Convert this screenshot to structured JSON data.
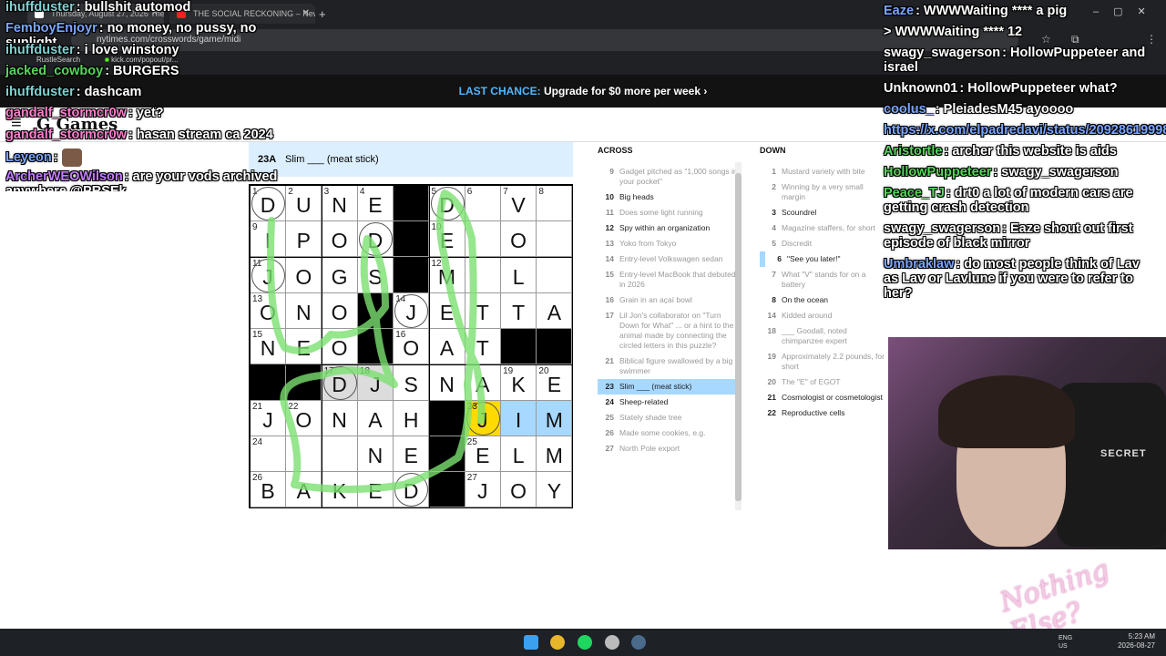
{
  "browser": {
    "tabs": [
      {
        "title": "Thursday, August 27, 2026 The"
      },
      {
        "title": "THE SOCIAL RECKONING – New"
      }
    ],
    "new_tab": "+",
    "url": "nytimes.com/crosswords/game/midi",
    "bookmarks": [
      "RustleSearch",
      "kick.com/popout/pr..."
    ]
  },
  "promo": {
    "highlight": "LAST CHANCE:",
    "text": "Upgrade for $0 more per week",
    "arrow": "›"
  },
  "header": {
    "menu": "≡",
    "logo": "G Games"
  },
  "clue_bar": {
    "number": "23A",
    "text": "Slim ___ (meat stick)"
  },
  "grid": {
    "rows": [
      "DUNE#DV.",
      "IPOD#E.O",
      "JOGS#M.L",
      "ONO#JETTA",
      "NEO#OAT##",
      "##DJSNAKE",
      "JONAH#JIM",
      "....NE#ELM",
      "BAKED#JOY"
    ],
    "cells": [
      [
        "D",
        "U",
        "N",
        "E",
        "#",
        "D",
        "",
        "V",
        ""
      ],
      [
        "I",
        "P",
        "O",
        "D",
        "#",
        "E",
        "",
        "O",
        ""
      ],
      [
        "J",
        "O",
        "G",
        "S",
        "#",
        "M",
        "",
        "L",
        ""
      ],
      [
        "O",
        "N",
        "O",
        "#",
        "J",
        "E",
        "T",
        "T",
        "A"
      ],
      [
        "N",
        "E",
        "O",
        "#",
        "O",
        "A",
        "T",
        "#",
        "#"
      ],
      [
        "#",
        "#",
        "D",
        "J",
        "S",
        "N",
        "A",
        "K",
        "E"
      ],
      [
        "J",
        "O",
        "N",
        "A",
        "H",
        "#",
        "J",
        "I",
        "M"
      ],
      [
        "",
        "",
        "",
        "N",
        "E",
        "#",
        "E",
        "L",
        "M"
      ],
      [
        "B",
        "A",
        "K",
        "E",
        "D",
        "#",
        "J",
        "O",
        "Y"
      ]
    ],
    "numbers": [
      [
        "1",
        "2",
        "3",
        "4",
        "",
        "5",
        "6",
        "7",
        "8"
      ],
      [
        "9",
        "",
        "",
        "",
        "",
        "10",
        "",
        "",
        ""
      ],
      [
        "11",
        "",
        "",
        "",
        "",
        "12",
        "",
        "",
        ""
      ],
      [
        "13",
        "",
        "",
        "",
        "14",
        "",
        "",
        "",
        ""
      ],
      [
        "15",
        "",
        "",
        "",
        "16",
        "",
        "",
        "",
        ""
      ],
      [
        "",
        "",
        "17",
        "18",
        "",
        "",
        "",
        "19",
        "20"
      ],
      [
        "21",
        "22",
        "",
        "",
        "",
        "",
        "23",
        "",
        ""
      ],
      [
        "24",
        "",
        "",
        "",
        "",
        "",
        "25",
        "",
        ""
      ],
      [
        "26",
        "",
        "",
        "",
        "",
        "",
        "27",
        "",
        ""
      ]
    ]
  },
  "across": {
    "heading": "ACROSS",
    "clues": [
      {
        "n": "9",
        "t": "Gadget pitched as \"1,000 songs in your pocket\"",
        "state": "done"
      },
      {
        "n": "10",
        "t": "Big heads",
        "state": ""
      },
      {
        "n": "11",
        "t": "Does some light running",
        "state": "done"
      },
      {
        "n": "12",
        "t": "Spy within an organization",
        "state": ""
      },
      {
        "n": "13",
        "t": "Yoko from Tokyo",
        "state": "done"
      },
      {
        "n": "14",
        "t": "Entry-level Volkswagen sedan",
        "state": "done"
      },
      {
        "n": "15",
        "t": "Entry-level MacBook that debuted in 2026",
        "state": "done"
      },
      {
        "n": "16",
        "t": "Grain in an açaí bowl",
        "state": "done"
      },
      {
        "n": "17",
        "t": "Lil Jon's collaborator on \"Turn Down for What\" ... or a hint to the animal made by connecting the circled letters in this puzzle?",
        "state": "done"
      },
      {
        "n": "21",
        "t": "Biblical figure swallowed by a big swimmer",
        "state": "done"
      },
      {
        "n": "23",
        "t": "Slim ___ (meat stick)",
        "state": "act"
      },
      {
        "n": "24",
        "t": "Sheep-related",
        "state": ""
      },
      {
        "n": "25",
        "t": "Stately shade tree",
        "state": "done"
      },
      {
        "n": "26",
        "t": "Made some cookies, e.g.",
        "state": "done"
      },
      {
        "n": "27",
        "t": "North Pole export",
        "state": "done"
      }
    ]
  },
  "down": {
    "heading": "DOWN",
    "clues": [
      {
        "n": "1",
        "t": "Mustard variety with bite",
        "state": "done"
      },
      {
        "n": "2",
        "t": "Winning by a very small margin",
        "state": "done"
      },
      {
        "n": "3",
        "t": "Scoundrel",
        "state": ""
      },
      {
        "n": "4",
        "t": "Magazine staffers, for short",
        "state": "done"
      },
      {
        "n": "5",
        "t": "Discredit",
        "state": "done"
      },
      {
        "n": "6",
        "t": "\"See you later!\"",
        "state": "cross"
      },
      {
        "n": "7",
        "t": "What \"V\" stands for on a battery",
        "state": "done"
      },
      {
        "n": "8",
        "t": "On the ocean",
        "state": ""
      },
      {
        "n": "14",
        "t": "Kidded around",
        "state": "done"
      },
      {
        "n": "18",
        "t": "___ Goodall, noted chimpanzee expert",
        "state": "done"
      },
      {
        "n": "19",
        "t": "Approximately 2.2 pounds, for short",
        "state": "done"
      },
      {
        "n": "20",
        "t": "The \"E\" of EGOT",
        "state": "done"
      },
      {
        "n": "21",
        "t": "Cosmologist or cosmetologist",
        "state": ""
      },
      {
        "n": "22",
        "t": "Reproductive cells",
        "state": ""
      }
    ]
  },
  "chat_left": [
    {
      "user": "ihuffduster",
      "color": "#7ed0d0",
      "msg": "bullshit automod"
    },
    {
      "user": "FemboyEnjoyr",
      "color": "#7aa6ff",
      "msg": "no money, no pussy, no sunlight"
    },
    {
      "user": "ihuffduster",
      "color": "#7ed0d0",
      "msg": "i love winstony"
    },
    {
      "user": "jacked_cowboy",
      "color": "#55d65a",
      "msg": "BURGERS"
    },
    {
      "user": "ihuffduster",
      "color": "#7ed0d0",
      "msg": "dashcam"
    },
    {
      "user": "gandalf_stormcr0w",
      "color": "#ff7fd0",
      "msg": "yet?"
    },
    {
      "user": "gandalf_stormcr0w",
      "color": "#ff7fd0",
      "msg": "hasan stream ca 2024"
    },
    {
      "user": "Leyeon",
      "color": "#7aa6ff",
      "msg": ""
    },
    {
      "user": "ArcherWEOWilson",
      "color": "#c37cff",
      "msg": "are your vods archived anywhere @PRSEk"
    }
  ],
  "chat_right": [
    {
      "user": "Eaze",
      "color": "#7aa6ff",
      "msg": "WWWWaiting **** a pig"
    },
    {
      "user": "",
      "color": "#ffffff",
      "msg": "> WWWWaiting **** 12"
    },
    {
      "user": "swagy_swagerson",
      "color": "#ffffff",
      "msg": "HollowPuppeteer and israel"
    },
    {
      "user": "Unknown01",
      "color": "#ffffff",
      "msg": "HollowPuppeteer what?"
    },
    {
      "user": "coolus_",
      "color": "#7aa6ff",
      "msg": "PleiadesM45 ayoooo"
    },
    {
      "user": "",
      "color": "#7aa6ff",
      "msg": "https://x.com/elpadredavi/status/2092861999860584779"
    },
    {
      "user": "Aristortle",
      "color": "#55d65a",
      "msg": "archer this website is aids"
    },
    {
      "user": "HollowPuppeteer",
      "color": "#55d65a",
      "msg": "swagy_swagerson"
    },
    {
      "user": "Peace_TJ",
      "color": "#55d65a",
      "msg": "drt0 a lot of modern cars are getting crash detection"
    },
    {
      "user": "swagy_swagerson",
      "color": "#ffffff",
      "msg": "Eaze shout out first episode of black mirror"
    },
    {
      "user": "Umbraklaw",
      "color": "#7aa6ff",
      "msg": "do most people think of Lav as Lav or Lavlune if you were to refer to her?"
    }
  ],
  "webcam": {
    "chair_brand": "SECRET"
  },
  "watermark": "Nothing Else?",
  "taskbar": {
    "lang": "ENG US",
    "time": "5:23 AM",
    "date": "2026-08-27"
  }
}
